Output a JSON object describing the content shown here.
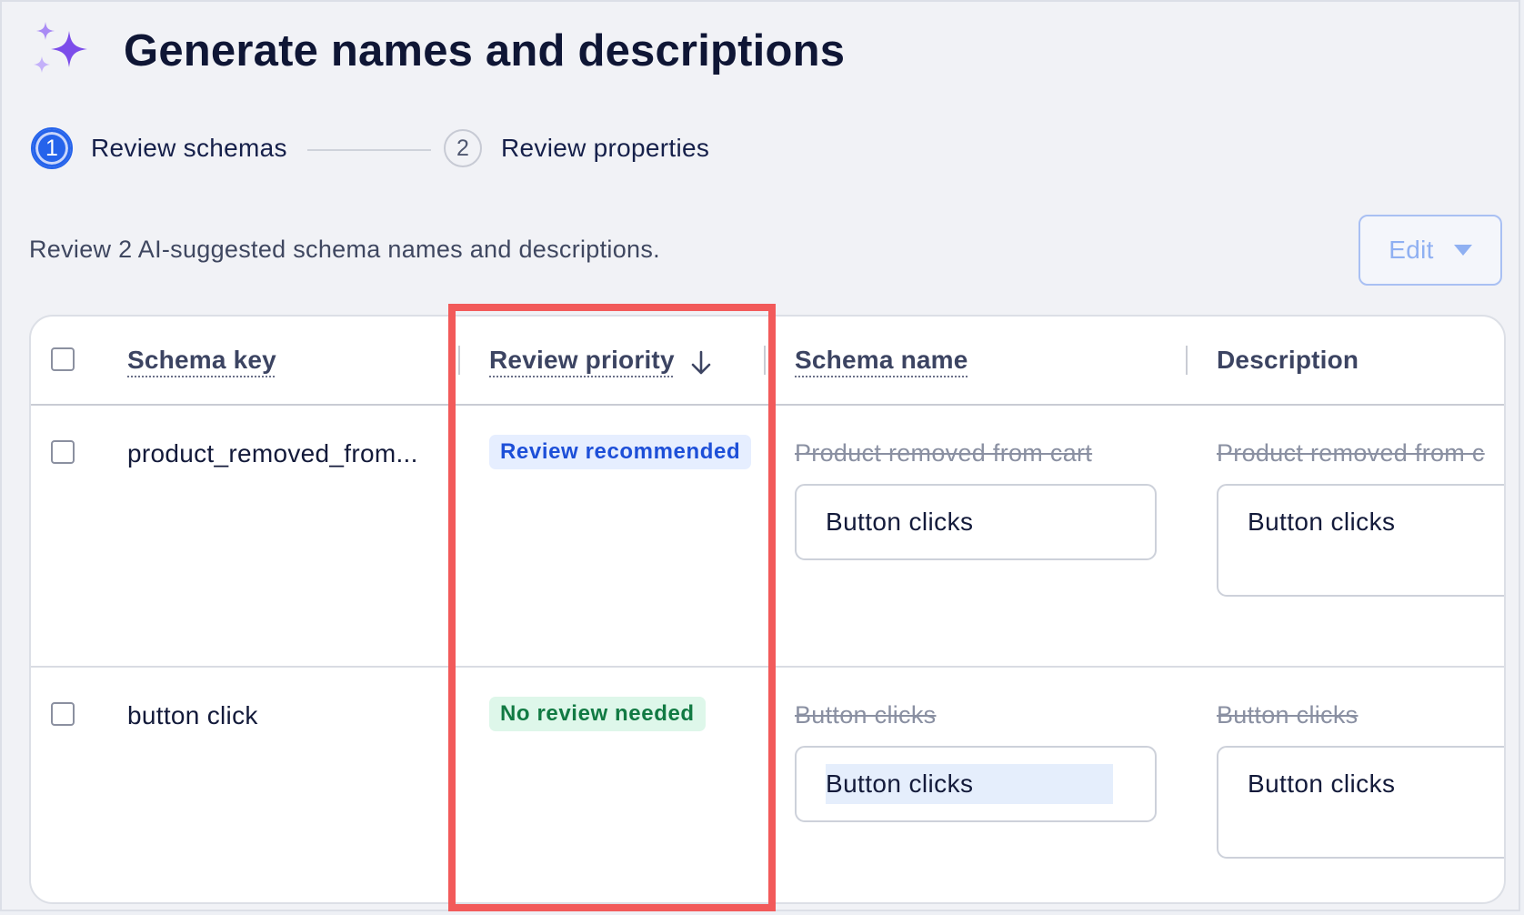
{
  "header": {
    "title": "Generate names and descriptions"
  },
  "stepper": {
    "steps": [
      {
        "number": "1",
        "label": "Review schemas",
        "active": true
      },
      {
        "number": "2",
        "label": "Review properties",
        "active": false
      }
    ]
  },
  "subtitle": "Review 2 AI-suggested schema names and descriptions.",
  "toolbar": {
    "edit_label": "Edit"
  },
  "table": {
    "columns": [
      "Schema key",
      "Review priority",
      "Schema name",
      "Description"
    ],
    "rows": [
      {
        "schema_key": "product_removed_from...",
        "priority": "Review recommended",
        "old_name": "Product removed from cart",
        "new_name": "Button clicks",
        "old_description": "Product removed from c",
        "new_description": "Button clicks"
      },
      {
        "schema_key": "button click",
        "priority": "No review needed",
        "old_name": "Button clicks",
        "new_name": "Button clicks",
        "old_description": "Button clicks",
        "new_description": "Button clicks"
      }
    ]
  },
  "colors": {
    "accent": "#2563eb",
    "highlight": "#f25a5a",
    "badge_blue_bg": "#e6eeff",
    "badge_green_bg": "#def7ea"
  }
}
